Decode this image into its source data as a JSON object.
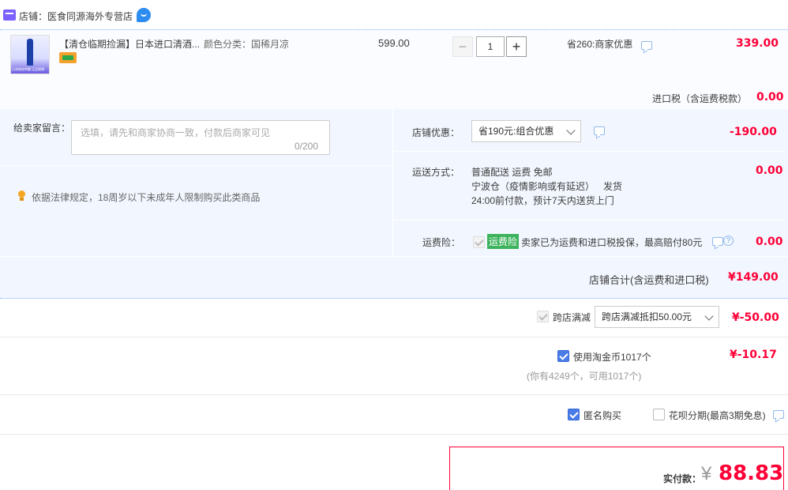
{
  "shop": {
    "label": "店铺：",
    "name": "医食同源海外专营店"
  },
  "item": {
    "title": "【清仓临期捡漏】日本进口清酒...",
    "sku_label": "颜色分类：",
    "sku_value": "国稀月凉",
    "unit_price": "599.00",
    "quantity": "1",
    "discount_text": "省260:商家优惠",
    "subtotal": "339.00",
    "thumb_caption": "日本纯米吟酿 正品保障"
  },
  "tax": {
    "label": "进口税（含运费税款）",
    "value": "0.00"
  },
  "message": {
    "label": "给卖家留言：",
    "placeholder": "选填，请先和商家协商一致，付款后商家可见",
    "counter": "0/200"
  },
  "notice": {
    "text": "依据法律规定，18周岁以下未成年人限制购买此类商品"
  },
  "shop_discount": {
    "label": "店铺优惠：",
    "selected": "省190元:组合优惠",
    "value": "-190.00"
  },
  "shipping": {
    "label": "运送方式：",
    "line1": "普通配送 运费 免邮",
    "line2a": "宁波仓（疫情影响或有延迟）",
    "line2b": "发货",
    "line3": "24:00前付款，预计7天内送货上门",
    "value": "0.00"
  },
  "insurance": {
    "label": "运费险：",
    "badge": "运费险",
    "text": "卖家已为运费和进口税投保，最高赔付80元",
    "value": "0.00"
  },
  "shop_total": {
    "label": "店铺合计(含运费和进口税)",
    "value": "¥149.00"
  },
  "cross_shop": {
    "label": "跨店满减",
    "selected": "跨店满减抵扣50.00元",
    "value": "¥-50.00"
  },
  "coins": {
    "label": "使用淘金币1017个",
    "sub": "(你有4249个，可用1017个)",
    "value": "¥-10.17"
  },
  "options": {
    "anonymous": "匿名购买",
    "huabei": "花呗分期(最高3期免息)"
  },
  "payment": {
    "label": "实付款：",
    "currency": "¥",
    "amount": "88.83"
  },
  "colors": {
    "accent_red": "#ff0036",
    "border_blue": "#80b2ff",
    "panel_blue": "#f2f7ff",
    "badge_green": "#3cb35c"
  }
}
